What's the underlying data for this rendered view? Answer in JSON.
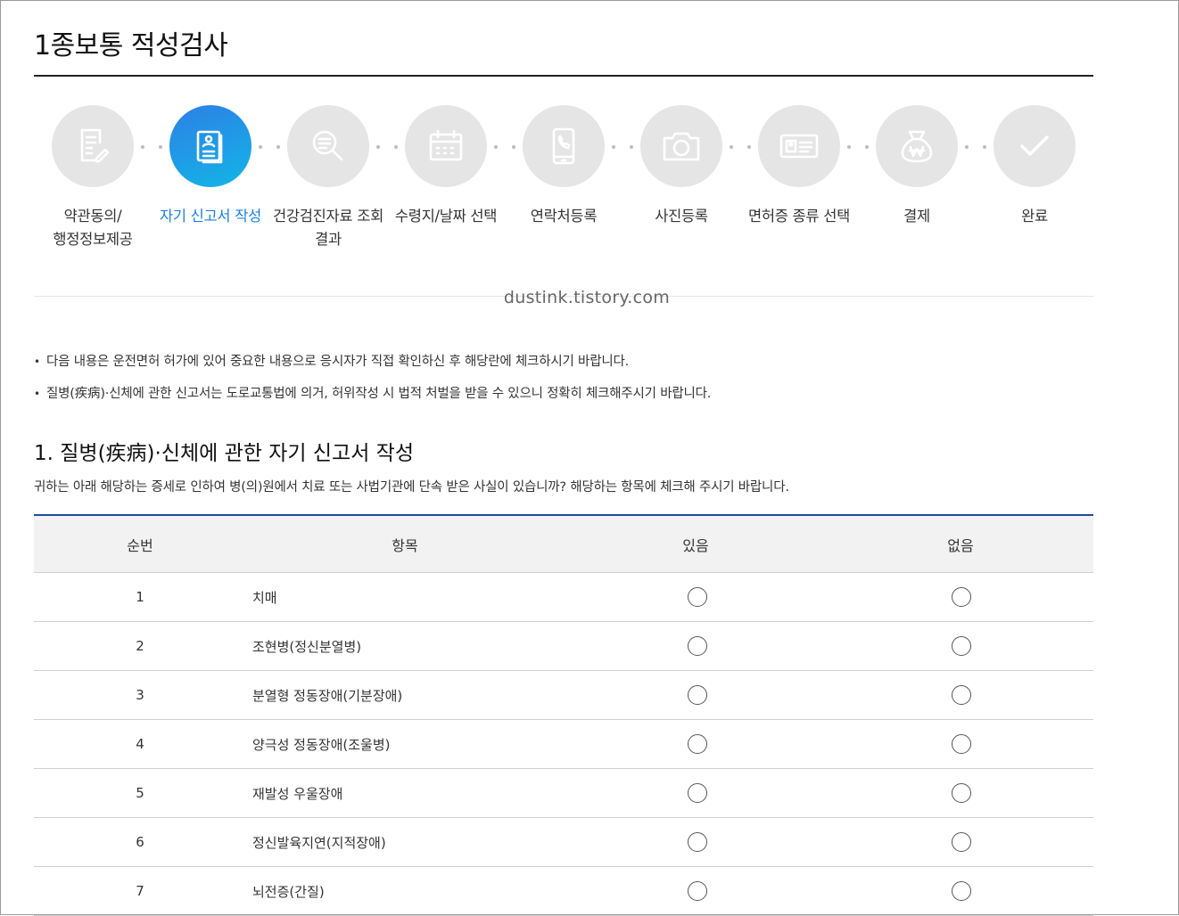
{
  "page_title": "1종보통 적성검사",
  "steps": [
    {
      "label_lines": [
        "약관동의/",
        "행정정보제공"
      ],
      "icon": "document-pen-icon",
      "active": false
    },
    {
      "label_lines": [
        "자기 신고서 작성"
      ],
      "icon": "self-report-icon",
      "active": true
    },
    {
      "label_lines": [
        "건강검진자료 조회",
        "결과"
      ],
      "icon": "magnifier-icon",
      "active": false
    },
    {
      "label_lines": [
        "수령지/날짜 선택"
      ],
      "icon": "calendar-icon",
      "active": false
    },
    {
      "label_lines": [
        "연락처등록"
      ],
      "icon": "phone-icon",
      "active": false
    },
    {
      "label_lines": [
        "사진등록"
      ],
      "icon": "camera-icon",
      "active": false
    },
    {
      "label_lines": [
        "면허증 종류 선택"
      ],
      "icon": "license-card-icon",
      "active": false
    },
    {
      "label_lines": [
        "결제"
      ],
      "icon": "won-bag-icon",
      "active": false
    },
    {
      "label_lines": [
        "완료"
      ],
      "icon": "check-icon",
      "active": false
    }
  ],
  "watermark": "dustink.tistory.com",
  "notices": [
    "다음 내용은 운전면허 허가에 있어 중요한 내용으로 응시자가 직접 확인하신 후 해당란에 체크하시기 바랍니다.",
    "질병(疾病)·신체에 관한 신고서는 도로교통법에 의거, 허위작성 시 법적 처벌을 받을 수 있으니 정확히 체크해주시기 바랍니다."
  ],
  "section": {
    "title": "1. 질병(疾病)·신체에 관한 자기 신고서 작성",
    "description": "귀하는 아래 해당하는 증세로 인하여 병(의)원에서 치료 또는 사법기관에 단속 받은 사실이 있습니까? 해당하는 항목에 체크해 주시기 바랍니다."
  },
  "table": {
    "headers": {
      "num": "순번",
      "item": "항목",
      "yes": "있음",
      "no": "없음"
    },
    "rows": [
      {
        "num": "1",
        "item": "치매"
      },
      {
        "num": "2",
        "item": "조현병(정신분열병)"
      },
      {
        "num": "3",
        "item": "분열형 정동장애(기분장애)"
      },
      {
        "num": "4",
        "item": "양극성 정동장애(조울병)"
      },
      {
        "num": "5",
        "item": "재발성 우울장애"
      },
      {
        "num": "6",
        "item": "정신발육지연(지적장애)"
      },
      {
        "num": "7",
        "item": "뇌전증(간질)"
      }
    ]
  },
  "colors": {
    "accent": "#1a7fe0",
    "table_border": "#1f4e9c",
    "step_inactive": "#e5e5e5"
  }
}
